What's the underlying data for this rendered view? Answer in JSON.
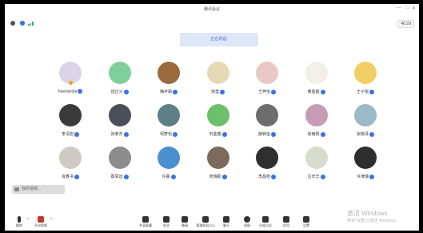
{
  "window": {
    "title": "腾讯会议"
  },
  "status": {
    "timer": "40:29"
  },
  "speaking_banner": "正在讲话:",
  "participants": [
    {
      "name": "huwaiyidai",
      "color": "#d9d4ea",
      "host": true
    },
    {
      "name": "饶正义",
      "color": "#7fcf9b"
    },
    {
      "name": "梅宇娟",
      "color": "#9a6a3c"
    },
    {
      "name": "徐莹",
      "color": "#e6d9b8"
    },
    {
      "name": "王梓怡",
      "color": "#e8c9c3"
    },
    {
      "name": "黄金超",
      "color": "#f3efe6"
    },
    {
      "name": "王子悦",
      "color": "#f1cf64"
    },
    {
      "name": "李清岩",
      "color": "#3a3a3a"
    },
    {
      "name": "张孝杰",
      "color": "#4b4f58"
    },
    {
      "name": "柯梦怡",
      "color": "#5e7f86"
    },
    {
      "name": "刘金鑫",
      "color": "#6cc06c"
    },
    {
      "name": "薛钟运",
      "color": "#6d6d6d"
    },
    {
      "name": "张雨阳",
      "color": "#c79ab6"
    },
    {
      "name": "张晓泽",
      "color": "#9bb9c7"
    },
    {
      "name": "肖雅书",
      "color": "#cfc9c4"
    },
    {
      "name": "蔡思远",
      "color": "#8c8c8c"
    },
    {
      "name": "许童",
      "color": "#4a8fd0"
    },
    {
      "name": "张瑞勤",
      "color": "#7d6a5c"
    },
    {
      "name": "李昌桂",
      "color": "#2f2f2f"
    },
    {
      "name": "吕天华",
      "color": "#d7dccc"
    },
    {
      "name": "许津瑞",
      "color": "#2e2e2e"
    }
  ],
  "self_view": {
    "label": "我的视频..."
  },
  "toolbar": {
    "mute": "解除",
    "video": "开启视频",
    "items": [
      {
        "label": "共享屏幕",
        "icon": "share-screen-icon"
      },
      {
        "label": "安全",
        "icon": "shield-icon"
      },
      {
        "label": "邀请",
        "icon": "invite-icon"
      },
      {
        "label": "管理成员(21)",
        "icon": "members-icon"
      },
      {
        "label": "聊天",
        "icon": "chat-icon"
      },
      {
        "label": "表情",
        "icon": "reaction-icon"
      },
      {
        "label": "分组讨论",
        "icon": "breakout-icon"
      },
      {
        "label": "应用",
        "icon": "apps-icon"
      },
      {
        "label": "设置",
        "icon": "settings-icon"
      }
    ]
  },
  "watermark": {
    "line1": "激活 Windows",
    "line2": "转到\"设置\"以激活 Windows。"
  }
}
